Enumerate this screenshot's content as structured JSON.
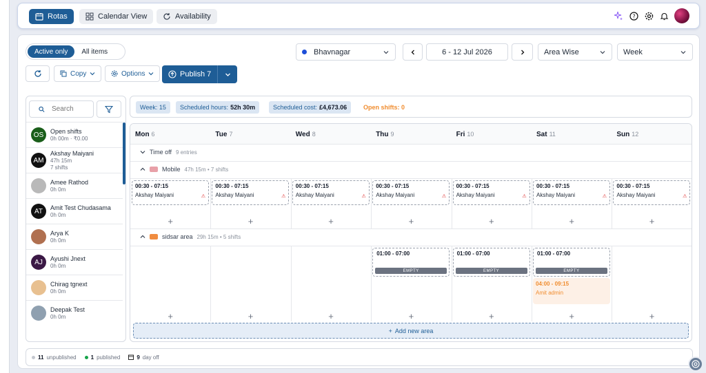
{
  "tabs": [
    {
      "label": "Rotas",
      "icon": "calendar-icon",
      "active": true
    },
    {
      "label": "Calendar View",
      "icon": "grid-icon",
      "active": false
    },
    {
      "label": "Availability",
      "icon": "refresh-icon",
      "active": false
    }
  ],
  "top_icons": [
    "sparkle-icon",
    "help-icon",
    "gear-icon",
    "bell-icon",
    "avatar"
  ],
  "toolbar": {
    "active_only": "Active only",
    "all_items": "All items",
    "copy": "Copy",
    "options": "Options",
    "publish": "Publish 7",
    "location": "Bhavnagar",
    "date_range": "6 - 12 Jul 2026",
    "view_mode": "Area Wise",
    "period": "Week"
  },
  "sidebar": {
    "search_placeholder": "Search",
    "employees": [
      {
        "initials": "OS",
        "name": "Open shifts",
        "sub": "0h 00m · ₹0.00",
        "sub2": "",
        "color": "#1a5e1a"
      },
      {
        "initials": "AM",
        "name": "Akshay Maiyani",
        "sub": "47h 15m",
        "sub2": "7 shifts",
        "color": "#111111"
      },
      {
        "initials": "",
        "name": "Amee Rathod",
        "sub": "0h 0m",
        "sub2": "",
        "color": "#b9b9b9"
      },
      {
        "initials": "AT",
        "name": "Amit Test Chudasama",
        "sub": "0h 0m",
        "sub2": "",
        "color": "#111111"
      },
      {
        "initials": "",
        "name": "Arya K",
        "sub": "0h 0m",
        "sub2": "",
        "color": "#b07050"
      },
      {
        "initials": "AJ",
        "name": "Ayushi Jnext",
        "sub": "0h 0m",
        "sub2": "",
        "color": "#3b1845"
      },
      {
        "initials": "",
        "name": "Chirag tgnext",
        "sub": "0h 0m",
        "sub2": "",
        "color": "#e8c090"
      },
      {
        "initials": "",
        "name": "Deepak Test",
        "sub": "0h 0m",
        "sub2": "",
        "color": "#8fa0b0"
      }
    ]
  },
  "stats": {
    "week": "Week: 15",
    "hours_label": "Scheduled hours:",
    "hours_value": "52h 30m",
    "cost_label": "Scheduled cost:",
    "cost_value": "£4,673.06",
    "open_shifts": "Open shifts: 0"
  },
  "days": [
    {
      "name": "Mon",
      "num": "6"
    },
    {
      "name": "Tue",
      "num": "7"
    },
    {
      "name": "Wed",
      "num": "8"
    },
    {
      "name": "Thu",
      "num": "9"
    },
    {
      "name": "Fri",
      "num": "10"
    },
    {
      "name": "Sat",
      "num": "11"
    },
    {
      "name": "Sun",
      "num": "12"
    }
  ],
  "groups": {
    "timeoff": {
      "label": "Time off",
      "meta": "9 entries"
    },
    "mobile": {
      "label": "Mobile",
      "meta": "47h 15m • 7 shifts",
      "color": "#e8a0a8"
    },
    "sidsar": {
      "label": "sidsar area",
      "meta": "29h 15m • 5 shifts",
      "color": "#f08c40"
    }
  },
  "mobile_shift": {
    "time": "00:30 - 07:15",
    "name": "Akshay Maiyani"
  },
  "sidsar_shift": {
    "time": "01:00 - 07:00",
    "tag": "EMPTY"
  },
  "sat_extra": {
    "time": "04:00 - 09:15",
    "name": "Amit admin"
  },
  "add_area": "Add new area",
  "footer": {
    "unpublished_count": "11",
    "unpublished": "unpublished",
    "published_count": "1",
    "published": "published",
    "dayoff_count": "9",
    "dayoff": "day off"
  }
}
